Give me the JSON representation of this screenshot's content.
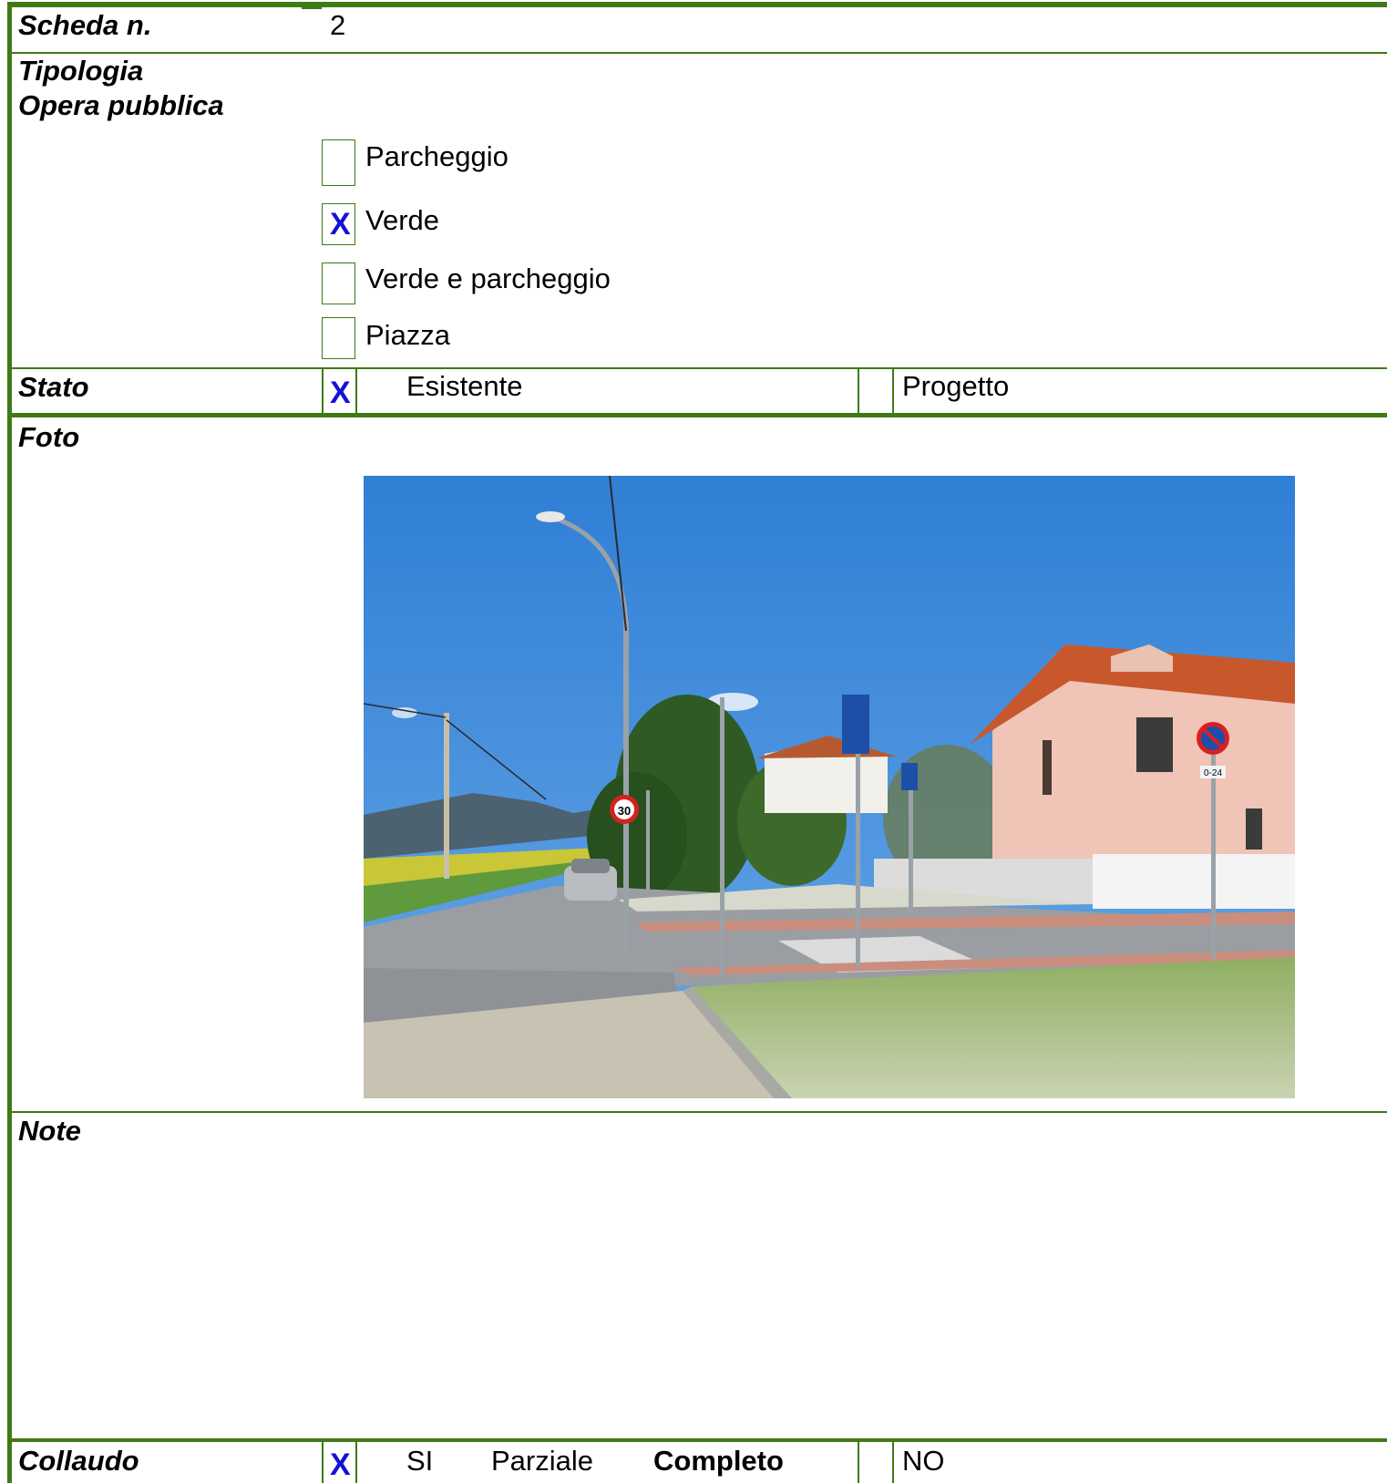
{
  "scheda": {
    "label": "Scheda n.",
    "value": "2"
  },
  "tipologia": {
    "label_line1": "Tipologia",
    "label_line2": "Opera pubblica",
    "options": [
      {
        "label": "Parcheggio",
        "checked": false
      },
      {
        "label": "Verde",
        "checked": true
      },
      {
        "label": "Verde e parcheggio",
        "checked": false
      },
      {
        "label": "Piazza",
        "checked": false
      }
    ]
  },
  "stato": {
    "label": "Stato",
    "mark": "X",
    "esistente": "Esistente",
    "progetto": "Progetto"
  },
  "foto": {
    "label": "Foto",
    "sign_speed": "30",
    "sign_plate": "0-24"
  },
  "note": {
    "label": "Note"
  },
  "collaudo": {
    "label": "Collaudo",
    "mark": "X",
    "si": "SI",
    "parziale": "Parziale",
    "completo": "Completo",
    "no": "NO"
  },
  "mark_symbol": "X",
  "colors": {
    "border": "#3f7a16",
    "mark": "#1212d6"
  }
}
